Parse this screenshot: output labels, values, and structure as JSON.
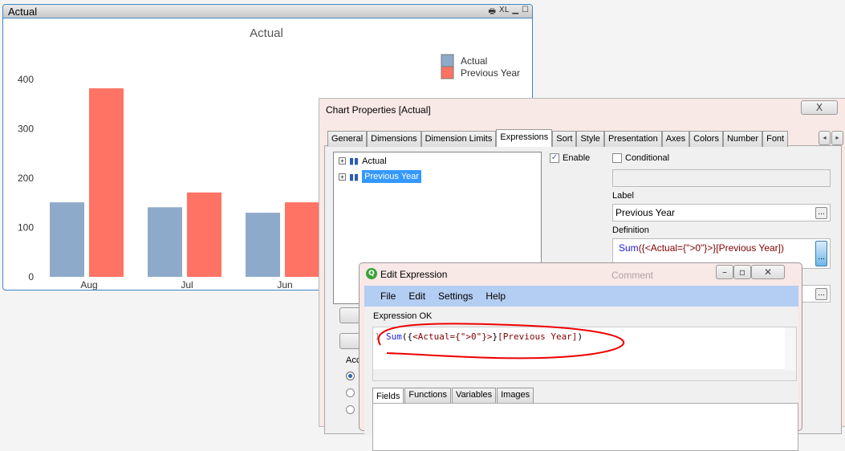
{
  "chart_window": {
    "caption": "Actual",
    "caption_icons": [
      "print-icon",
      "XL",
      "minimize-icon",
      "maximize-icon"
    ]
  },
  "chart_data": {
    "type": "bar",
    "title": "Actual",
    "categories": [
      "Aug",
      "Jul",
      "Jun"
    ],
    "series": [
      {
        "name": "Actual",
        "color": "#8eaacb",
        "values": [
          151,
          141,
          130
        ]
      },
      {
        "name": "Previous Year",
        "color": "#ff7364",
        "values": [
          382,
          171,
          151
        ]
      }
    ],
    "yticks": [
      0,
      100,
      200,
      300,
      400
    ],
    "ylim": [
      0,
      400
    ],
    "legend": "top-right",
    "grid": false
  },
  "props": {
    "title": "Chart Properties [Actual]",
    "close": "X",
    "tabs": [
      "General",
      "Dimensions",
      "Dimension Limits",
      "Expressions",
      "Sort",
      "Style",
      "Presentation",
      "Axes",
      "Colors",
      "Number",
      "Font"
    ],
    "active_tab": "Expressions",
    "expressions": [
      "Actual",
      "Previous Year"
    ],
    "enable_label": "Enable",
    "conditional_label": "Conditional",
    "label_caption": "Label",
    "label_value": "Previous Year",
    "definition_caption": "Definition",
    "def_func": "Sum",
    "def_mid": "({<Actual={\">0\"}>}",
    "def_field": "[Previous Year])",
    "comment_caption": "Comment",
    "acc_partial": "Acc",
    "dots": "..."
  },
  "edit": {
    "title": "Edit Expression",
    "menu": [
      "File",
      "Edit",
      "Settings",
      "Help"
    ],
    "status": "Expression OK",
    "line_no": "1",
    "code_func": "Sum",
    "code_open": "({",
    "code_set": "<Actual={\">0\"}>",
    "code_close": "}",
    "code_field": "[Previous Year]",
    "code_end": ")",
    "tabs": [
      "Fields",
      "Functions",
      "Variables",
      "Images"
    ]
  }
}
